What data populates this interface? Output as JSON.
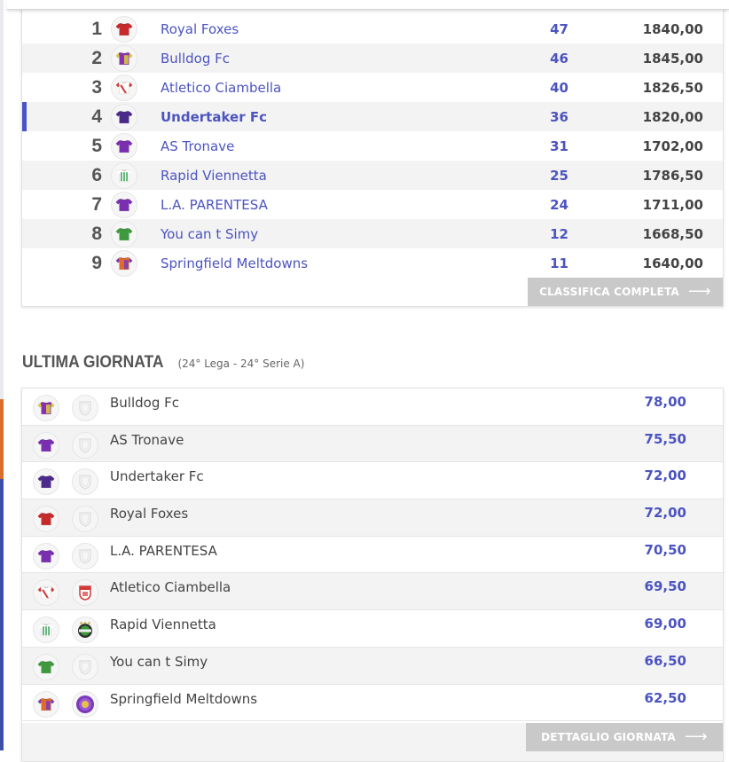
{
  "colors": {
    "accent": "#4c54c0",
    "button_bg": "#c9c9c9",
    "row_alt": "#f3f3f3"
  },
  "standings": {
    "highlighted_position": "4",
    "rows": [
      {
        "pos": "1",
        "team": "Royal Foxes",
        "points": "47",
        "total": "1840,00",
        "jersey": "jersey-red-icon"
      },
      {
        "pos": "2",
        "team": "Bulldog Fc",
        "points": "46",
        "total": "1845,00",
        "jersey": "jersey-purple-yellow-icon"
      },
      {
        "pos": "3",
        "team": "Atletico Ciambella",
        "points": "40",
        "total": "1826,50",
        "jersey": "jersey-red-white-icon"
      },
      {
        "pos": "4",
        "team": "Undertaker Fc",
        "points": "36",
        "total": "1820,00",
        "jersey": "jersey-dark-purple-icon"
      },
      {
        "pos": "5",
        "team": "AS Tronave",
        "points": "31",
        "total": "1702,00",
        "jersey": "jersey-purple-icon"
      },
      {
        "pos": "6",
        "team": "Rapid Viennetta",
        "points": "25",
        "total": "1786,50",
        "jersey": "jersey-green-stripes-icon"
      },
      {
        "pos": "7",
        "team": "L.A. PARENTESA",
        "points": "24",
        "total": "1711,00",
        "jersey": "jersey-purple-icon"
      },
      {
        "pos": "8",
        "team": "You can t Simy",
        "points": "12",
        "total": "1668,50",
        "jersey": "jersey-green-icon"
      },
      {
        "pos": "9",
        "team": "Springfield Meltdowns",
        "points": "11",
        "total": "1640,00",
        "jersey": "jersey-orange-purple-icon"
      }
    ],
    "button_label": "CLASSIFICA COMPLETA",
    "button_arrow": "⟶"
  },
  "last_round": {
    "title": "ULTIMA GIORNATA",
    "subtitle": "(24° Lega - 24° Serie A)",
    "rows": [
      {
        "team": "Bulldog Fc",
        "score": "78,00",
        "jersey": "jersey-purple-yellow-icon",
        "crest": "shield-placeholder-icon"
      },
      {
        "team": "AS Tronave",
        "score": "75,50",
        "jersey": "jersey-purple-icon",
        "crest": "shield-placeholder-icon"
      },
      {
        "team": "Undertaker Fc",
        "score": "72,00",
        "jersey": "jersey-dark-purple-icon",
        "crest": "shield-placeholder-icon"
      },
      {
        "team": "Royal Foxes",
        "score": "72,00",
        "jersey": "jersey-red-icon",
        "crest": "shield-placeholder-icon"
      },
      {
        "team": "L.A. PARENTESA",
        "score": "70,50",
        "jersey": "jersey-purple-icon",
        "crest": "shield-placeholder-icon"
      },
      {
        "team": "Atletico Ciambella",
        "score": "69,50",
        "jersey": "jersey-red-white-icon",
        "crest": "red-white-crest-icon"
      },
      {
        "team": "Rapid Viennetta",
        "score": "69,00",
        "jersey": "jersey-green-stripes-icon",
        "crest": "green-black-crest-icon"
      },
      {
        "team": "You can t Simy",
        "score": "66,50",
        "jersey": "jersey-green-icon",
        "crest": "shield-placeholder-icon"
      },
      {
        "team": "Springfield Meltdowns",
        "score": "62,50",
        "jersey": "jersey-orange-purple-icon",
        "crest": "purple-round-crest-icon"
      }
    ],
    "button_label": "DETTAGLIO GIORNATA",
    "button_arrow": "⟶"
  }
}
